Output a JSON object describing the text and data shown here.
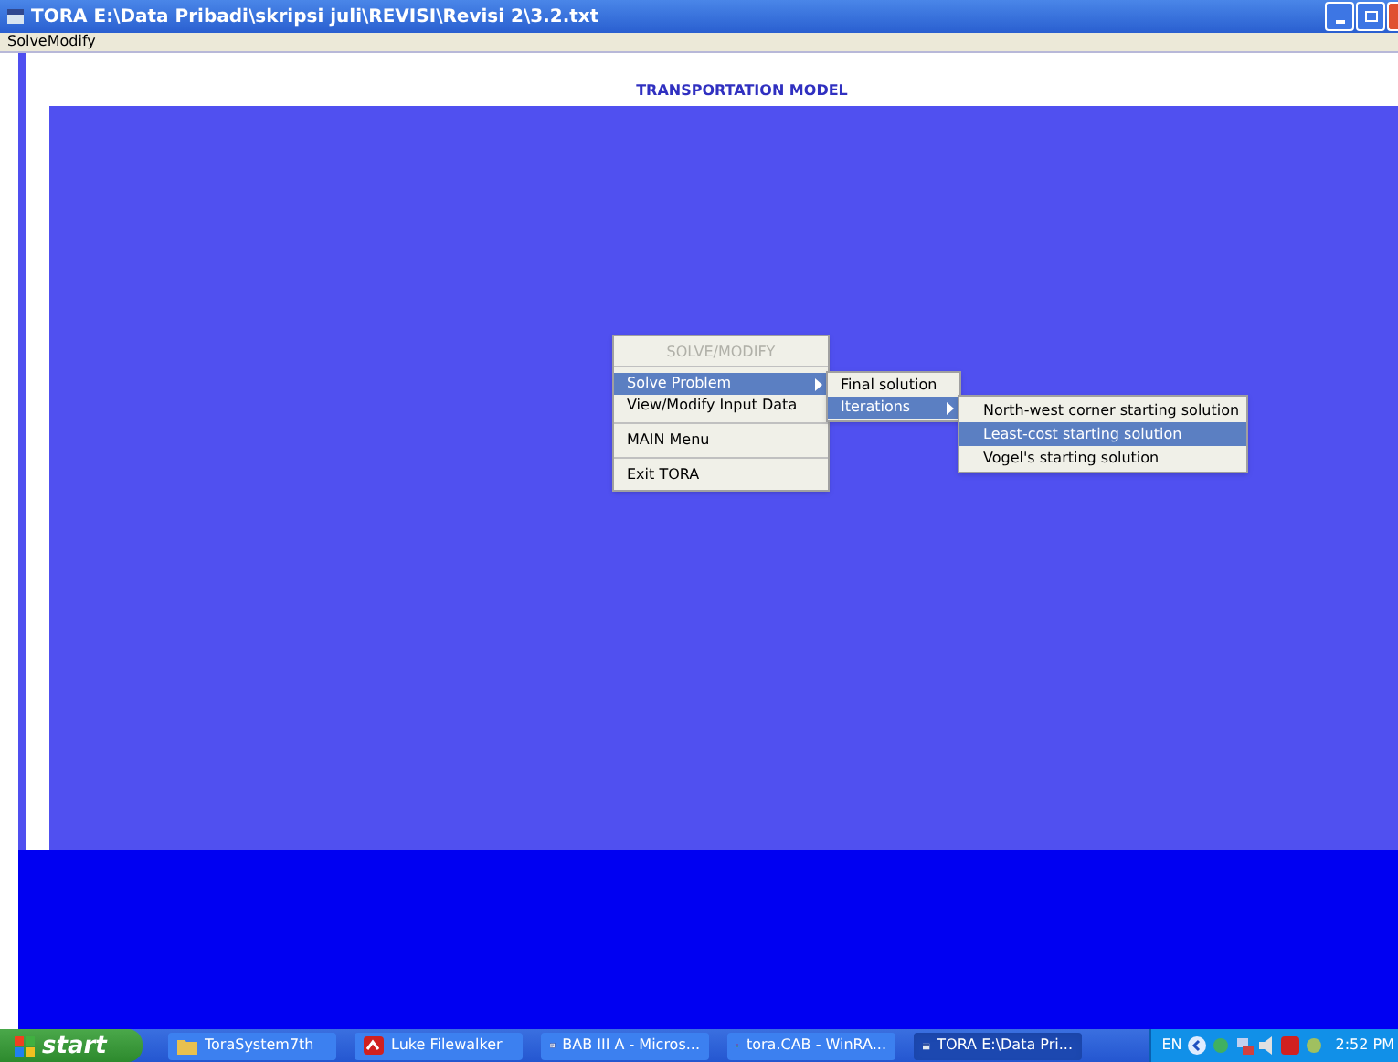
{
  "window": {
    "title": "TORA E:\\Data Pribadi\\skripsi juli\\REVISI\\Revisi 2\\3.2.txt"
  },
  "menu_bar": [
    "SolveModify"
  ],
  "heading": "TRANSPORTATION MODEL",
  "main_menu": {
    "title": "SOLVE/MODIFY",
    "items": [
      {
        "kind": "submenu",
        "label": "Solve Problem",
        "selected": true
      },
      {
        "kind": "command",
        "label": "View/Modify Input Data",
        "selected": false
      },
      {
        "kind": "separator"
      },
      {
        "kind": "command",
        "label": "MAIN Menu",
        "selected": false
      },
      {
        "kind": "separator"
      },
      {
        "kind": "command",
        "label": "Exit TORA",
        "selected": false
      }
    ]
  },
  "solve_menu": [
    {
      "kind": "command",
      "label": "Final solution",
      "selected": false
    },
    {
      "kind": "submenu",
      "label": "Iterations",
      "selected": true
    }
  ],
  "iterations_menu": [
    {
      "label": "North-west corner starting solution",
      "selected": false
    },
    {
      "label": "Least-cost starting solution",
      "selected": true
    },
    {
      "label": "Vogel's starting solution",
      "selected": false
    }
  ],
  "taskbar": {
    "start": "start",
    "buttons": [
      {
        "label": "ToraSystem7th",
        "kind": "folder",
        "selected": false
      },
      {
        "label": "Luke Filewalker",
        "kind": "app",
        "selected": false
      },
      {
        "label": "BAB III A - Micros...",
        "kind": "doc",
        "selected": false
      },
      {
        "label": "tora.CAB - WinRA...",
        "kind": "archive",
        "selected": false
      },
      {
        "label": "TORA E:\\Data Pri...",
        "kind": "window",
        "selected": true
      }
    ],
    "language": "EN",
    "clock": "2:52 PM"
  }
}
